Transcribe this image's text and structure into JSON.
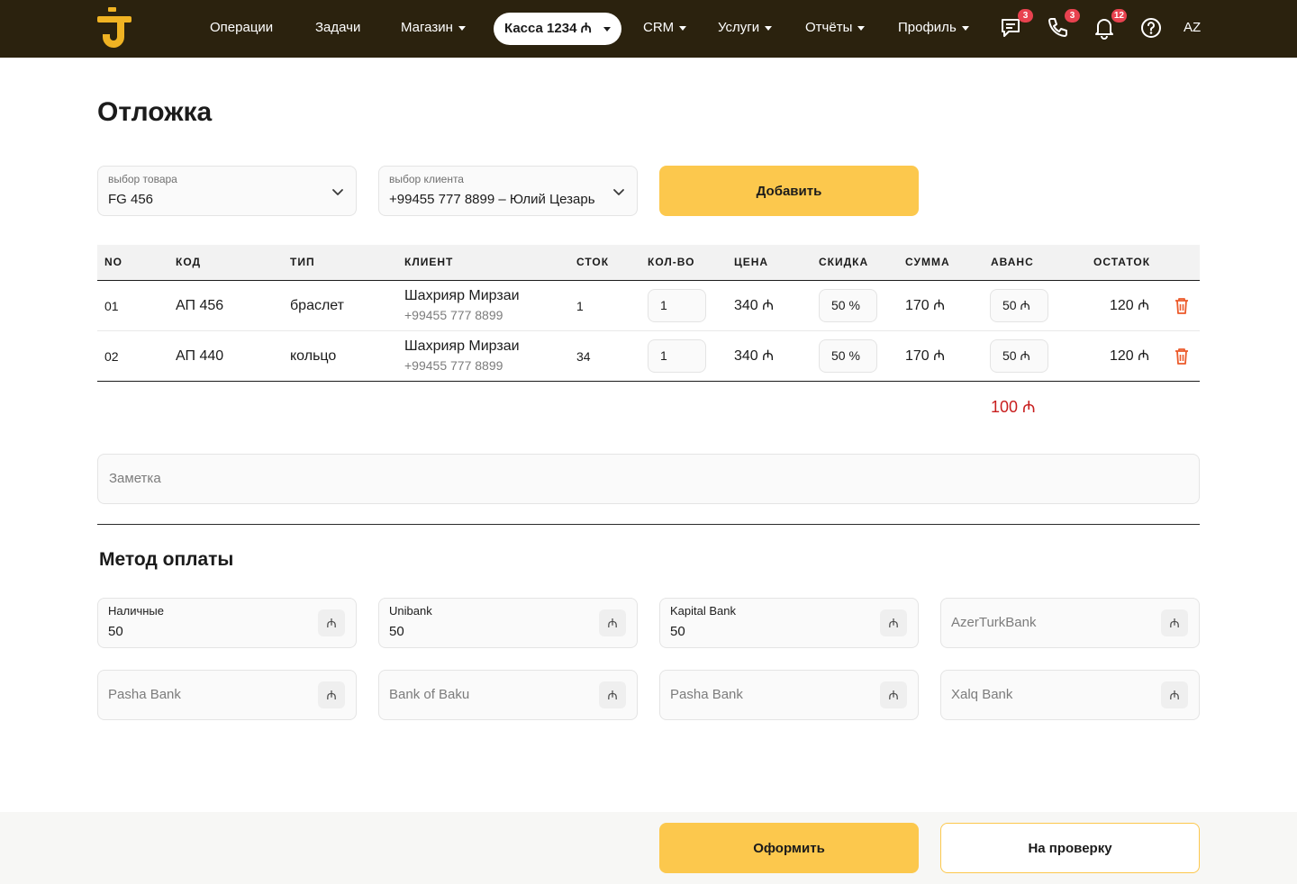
{
  "header": {
    "nav": {
      "operations": "Операции",
      "tasks": "Задачи",
      "shop": "Магазин",
      "kassa": "Касса 1234 ₼",
      "crm": "CRM",
      "services": "Услуги",
      "reports": "Отчёты",
      "profile": "Профиль"
    },
    "badges": {
      "messages": "3",
      "calls": "3",
      "notifications": "12"
    },
    "lang": "AZ",
    "colors": {
      "bar": "#2b220e",
      "accent": "#f0b323",
      "badge": "#e8424f"
    },
    "icons": [
      "logo-icon",
      "chat-icon",
      "phone-icon",
      "bell-icon",
      "help-icon"
    ]
  },
  "page": {
    "title": "Отложка"
  },
  "product_select": {
    "label": "выбор товара",
    "value": "FG 456"
  },
  "client_select": {
    "label": "выбор клиента",
    "value": "+99455 777 8899 – Юлий Цезарь"
  },
  "add_button": "Добавить",
  "table": {
    "headers": {
      "no": "NO",
      "code": "КОД",
      "type": "ТИП",
      "client": "КЛИЕНТ",
      "stock": "СТОК",
      "qty": "КОЛ-ВО",
      "price": "ЦЕНА",
      "discount": "СКИДКА",
      "sum": "СУММА",
      "advance": "АВАНС",
      "rest": "ОСТАТОК"
    },
    "rows": [
      {
        "no": "01",
        "code": "АП 456",
        "type": "браслет",
        "client_name": "Шахрияр Мирзаи",
        "client_phone": "+99455 777 8899",
        "stock": "1",
        "qty": "1",
        "price": "340 ₼",
        "discount": "50 %",
        "sum": "170 ₼",
        "advance": "50 ₼",
        "rest": "120 ₼"
      },
      {
        "no": "02",
        "code": "АП 440",
        "type": "кольцо",
        "client_name": "Шахрияр Мирзаи",
        "client_phone": "+99455 777 8899",
        "stock": "34",
        "qty": "1",
        "price": "340 ₼",
        "discount": "50 %",
        "sum": "170 ₼",
        "advance": "50 ₼",
        "rest": "120 ₼"
      }
    ],
    "total": "100 ₼"
  },
  "note": {
    "placeholder": "Заметка"
  },
  "payment": {
    "title": "Метод оплаты",
    "currency": "₼",
    "methods": [
      {
        "label": "Наличные",
        "value": "50"
      },
      {
        "label": "Unibank",
        "value": "50"
      },
      {
        "label": "Kapital Bank",
        "value": "50"
      },
      {
        "placeholder": "AzerTurkBank"
      },
      {
        "placeholder": "Pasha Bank"
      },
      {
        "placeholder": "Bank of Baku"
      },
      {
        "placeholder": "Pasha Bank"
      },
      {
        "placeholder": "Xalq Bank"
      }
    ]
  },
  "footer": {
    "submit": "Оформить",
    "review": "На проверку"
  }
}
